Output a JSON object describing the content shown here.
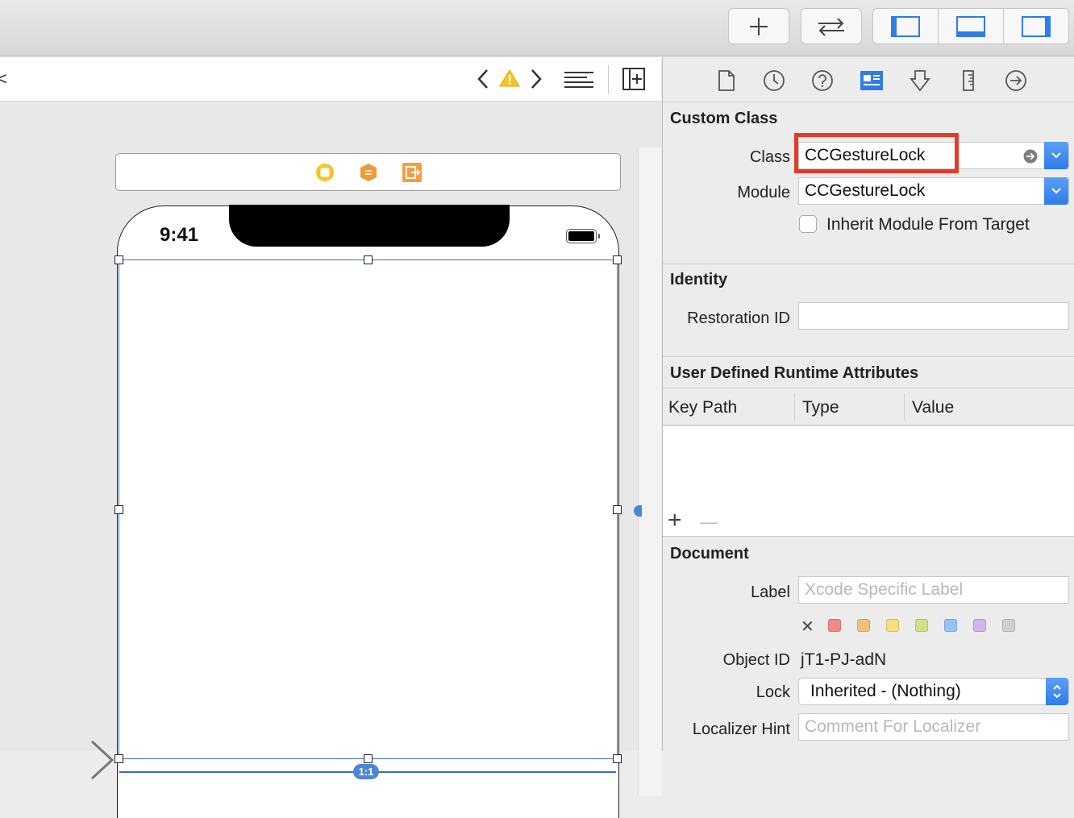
{
  "toolbar": {
    "add_icon": "plus-icon",
    "swap_icon": "arrows-left-right-icon",
    "panels": [
      "navigator-panel-icon",
      "debug-panel-icon",
      "inspector-panel-icon"
    ]
  },
  "jumpbar": {
    "edge_glyph": "<",
    "warning_icon": "warning-icon"
  },
  "canvas": {
    "status_time": "9:41",
    "ratio_badge": "1:1"
  },
  "inspector": {
    "tabs": [
      "file-icon",
      "history-icon",
      "help-icon",
      "identity-icon",
      "attributes-icon",
      "size-icon",
      "connections-icon"
    ],
    "custom_class": {
      "title": "Custom Class",
      "class_label": "Class",
      "class_value": "CCGestureLock",
      "module_label": "Module",
      "module_value": "CCGestureLock",
      "inherit_label": "Inherit Module From Target"
    },
    "identity": {
      "title": "Identity",
      "restoration_label": "Restoration ID",
      "restoration_value": ""
    },
    "runtime_attributes": {
      "title": "User Defined Runtime Attributes",
      "columns": [
        "Key Path",
        "Type",
        "Value"
      ],
      "add": "+",
      "remove": "—"
    },
    "document": {
      "title": "Document",
      "label_label": "Label",
      "label_placeholder": "Xcode Specific Label",
      "clear_glyph": "✕",
      "label_colors": [
        "#f08a84",
        "#f5bf7a",
        "#f6e07a",
        "#cfe47e",
        "#94c4f6",
        "#d5b3ee",
        "#cfcfcf"
      ],
      "object_id_label": "Object ID",
      "object_id_value": "jT1-PJ-adN",
      "lock_label": "Lock",
      "lock_value": "Inherited - (Nothing)",
      "hint_label": "Localizer Hint",
      "hint_placeholder": "Comment For Localizer"
    }
  },
  "colors": {
    "highlight_red": "#e53a28",
    "accent_blue": "#2f7ce9"
  }
}
